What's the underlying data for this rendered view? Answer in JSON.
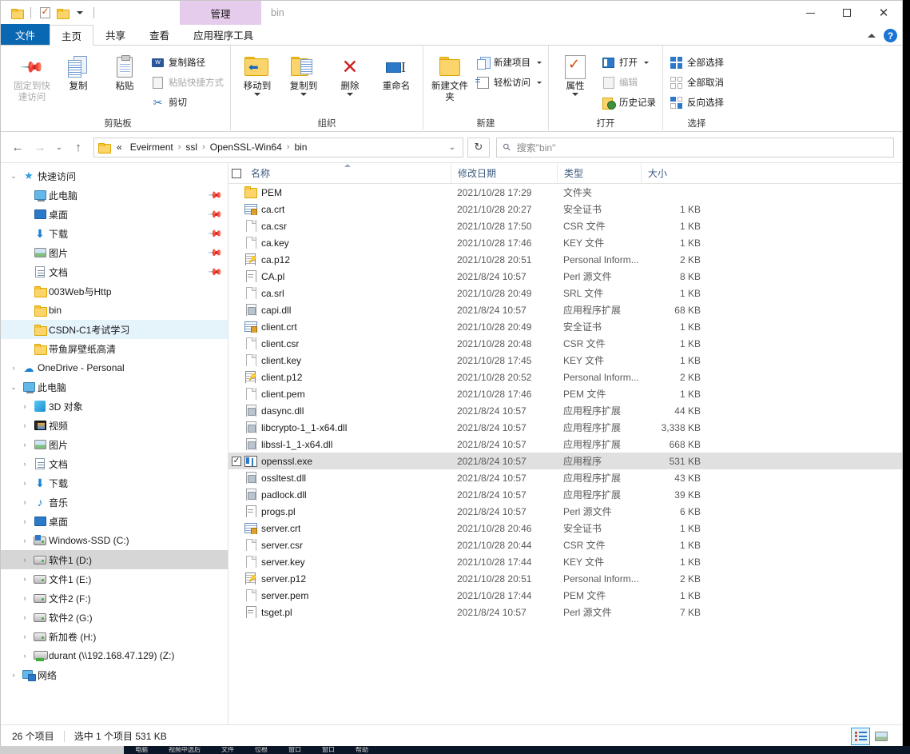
{
  "window": {
    "title": "bin",
    "context_tab": "管理",
    "minimize": "—",
    "maximize": "□",
    "close": "✕"
  },
  "quick_access_toolbar": [
    {
      "name": "qat-folder-properties",
      "icon": "folder-icon"
    },
    {
      "name": "qat-properties",
      "icon": "properties-check-icon"
    },
    {
      "name": "qat-new-folder",
      "icon": "folder-icon"
    },
    {
      "name": "qat-customize",
      "icon": "chevron-down-icon"
    }
  ],
  "tabs": [
    {
      "label": "文件",
      "id": "file",
      "state": "file"
    },
    {
      "label": "主页",
      "id": "home",
      "state": "active"
    },
    {
      "label": "共享",
      "id": "share",
      "state": "normal"
    },
    {
      "label": "查看",
      "id": "view",
      "state": "normal"
    },
    {
      "label": "应用程序工具",
      "id": "apptools",
      "state": "context"
    }
  ],
  "ribbon": {
    "collapse_tooltip": "^",
    "help_label": "?",
    "groups": [
      {
        "title": "剪贴板",
        "big_buttons": [
          {
            "label": "固定到快速访问",
            "icon": "pin-icon",
            "dim": true
          },
          {
            "label": "复制",
            "icon": "copy-icon",
            "dim": false
          },
          {
            "label": "粘贴",
            "icon": "paste-icon",
            "dim": false
          }
        ],
        "small_buttons": [
          {
            "label": "复制路径",
            "icon": "copy-path-icon",
            "dim": false
          },
          {
            "label": "粘贴快捷方式",
            "icon": "paste-shortcut-icon",
            "dim": true
          },
          {
            "label": "剪切",
            "icon": "scissors-icon",
            "dim": false
          }
        ]
      },
      {
        "title": "组织",
        "big_buttons": [
          {
            "label": "移动到",
            "icon": "move-to-icon",
            "caret": true
          },
          {
            "label": "复制到",
            "icon": "copy-to-icon",
            "caret": true
          },
          {
            "label": "删除",
            "icon": "delete-x-icon",
            "caret": true
          },
          {
            "label": "重命名",
            "icon": "rename-icon",
            "caret": false
          }
        ]
      },
      {
        "title": "新建",
        "big_buttons": [
          {
            "label": "新建文件夹",
            "icon": "new-folder-icon"
          }
        ],
        "small_buttons": [
          {
            "label": "新建项目",
            "icon": "new-item-icon",
            "caret": true
          },
          {
            "label": "轻松访问",
            "icon": "easy-access-icon",
            "caret": true
          }
        ]
      },
      {
        "title": "打开",
        "big_buttons": [
          {
            "label": "属性",
            "icon": "properties-icon",
            "caret": true
          }
        ],
        "small_buttons": [
          {
            "label": "打开",
            "icon": "open-icon",
            "caret": true
          },
          {
            "label": "编辑",
            "icon": "edit-icon",
            "dim": true
          },
          {
            "label": "历史记录",
            "icon": "history-icon"
          }
        ]
      },
      {
        "title": "选择",
        "small_buttons": [
          {
            "label": "全部选择",
            "icon": "select-all-icon"
          },
          {
            "label": "全部取消",
            "icon": "select-none-icon"
          },
          {
            "label": "反向选择",
            "icon": "invert-selection-icon"
          }
        ]
      }
    ]
  },
  "address": {
    "back": "←",
    "forward": "→",
    "recent": "⌄",
    "up": "↑",
    "crumbs": [
      "«",
      "Eveirment",
      "ssl",
      "OpenSSL-Win64",
      "bin"
    ],
    "separator": "›",
    "dropdown": "⌄",
    "refresh": "↻",
    "search_placeholder": "搜索\"bin\"",
    "search_value": ""
  },
  "nav_pane": [
    {
      "label": "快速访问",
      "icon": "star-icon",
      "indent": 0,
      "toggle": "expanded",
      "pin": false,
      "state": "normal"
    },
    {
      "label": "此电脑",
      "icon": "pc-icon",
      "indent": 1,
      "toggle": "none",
      "pin": true,
      "state": "normal"
    },
    {
      "label": "桌面",
      "icon": "desktop-icon",
      "indent": 1,
      "toggle": "none",
      "pin": true,
      "state": "normal"
    },
    {
      "label": "下载",
      "icon": "download-icon",
      "indent": 1,
      "toggle": "none",
      "pin": true,
      "state": "normal"
    },
    {
      "label": "图片",
      "icon": "pictures-icon",
      "indent": 1,
      "toggle": "none",
      "pin": true,
      "state": "normal"
    },
    {
      "label": "文档",
      "icon": "documents-icon",
      "indent": 1,
      "toggle": "none",
      "pin": true,
      "state": "normal"
    },
    {
      "label": "003Web与Http",
      "icon": "folder-icon",
      "indent": 1,
      "toggle": "none",
      "pin": false,
      "state": "normal"
    },
    {
      "label": "bin",
      "icon": "folder-icon",
      "indent": 1,
      "toggle": "none",
      "pin": false,
      "state": "normal"
    },
    {
      "label": "CSDN-C1考试学习",
      "icon": "folder-icon",
      "indent": 1,
      "toggle": "none",
      "pin": false,
      "state": "selected"
    },
    {
      "label": "带鱼屏壁纸高清",
      "icon": "folder-icon",
      "indent": 1,
      "toggle": "none",
      "pin": false,
      "state": "normal"
    },
    {
      "label": "OneDrive - Personal",
      "icon": "cloud-icon",
      "indent": 0,
      "toggle": "collapsed",
      "pin": false,
      "state": "normal"
    },
    {
      "label": "此电脑",
      "icon": "pc-icon",
      "indent": 0,
      "toggle": "expanded",
      "pin": false,
      "state": "normal"
    },
    {
      "label": "3D 对象",
      "icon": "3d-objects-icon",
      "indent": 1,
      "toggle": "collapsed",
      "pin": false,
      "state": "normal"
    },
    {
      "label": "视频",
      "icon": "videos-icon",
      "indent": 1,
      "toggle": "collapsed",
      "pin": false,
      "state": "normal"
    },
    {
      "label": "图片",
      "icon": "pictures-icon",
      "indent": 1,
      "toggle": "collapsed",
      "pin": false,
      "state": "normal"
    },
    {
      "label": "文档",
      "icon": "documents-icon",
      "indent": 1,
      "toggle": "collapsed",
      "pin": false,
      "state": "normal"
    },
    {
      "label": "下载",
      "icon": "download-icon",
      "indent": 1,
      "toggle": "collapsed",
      "pin": false,
      "state": "normal"
    },
    {
      "label": "音乐",
      "icon": "music-icon",
      "indent": 1,
      "toggle": "collapsed",
      "pin": false,
      "state": "normal"
    },
    {
      "label": "桌面",
      "icon": "desktop-icon",
      "indent": 1,
      "toggle": "collapsed",
      "pin": false,
      "state": "normal"
    },
    {
      "label": "Windows-SSD (C:)",
      "icon": "drive-windows-icon",
      "indent": 1,
      "toggle": "collapsed",
      "pin": false,
      "state": "normal"
    },
    {
      "label": "软件1 (D:)",
      "icon": "drive-icon",
      "indent": 1,
      "toggle": "collapsed",
      "pin": false,
      "state": "selected-gray"
    },
    {
      "label": "文件1 (E:)",
      "icon": "drive-icon",
      "indent": 1,
      "toggle": "collapsed",
      "pin": false,
      "state": "normal"
    },
    {
      "label": "文件2 (F:)",
      "icon": "drive-icon",
      "indent": 1,
      "toggle": "collapsed",
      "pin": false,
      "state": "normal"
    },
    {
      "label": "软件2 (G:)",
      "icon": "drive-icon",
      "indent": 1,
      "toggle": "collapsed",
      "pin": false,
      "state": "normal"
    },
    {
      "label": "新加卷 (H:)",
      "icon": "drive-icon",
      "indent": 1,
      "toggle": "collapsed",
      "pin": false,
      "state": "normal"
    },
    {
      "label": "durant (\\\\192.168.47.129) (Z:)",
      "icon": "network-drive-icon",
      "indent": 1,
      "toggle": "collapsed",
      "pin": false,
      "state": "normal"
    },
    {
      "label": "网络",
      "icon": "network-icon",
      "indent": 0,
      "toggle": "collapsed",
      "pin": false,
      "state": "normal"
    }
  ],
  "file_list": {
    "columns": [
      {
        "label": "名称",
        "key": "name",
        "sorted": true
      },
      {
        "label": "修改日期",
        "key": "date",
        "sorted": false
      },
      {
        "label": "类型",
        "key": "type",
        "sorted": false
      },
      {
        "label": "大小",
        "key": "size",
        "sorted": false
      }
    ],
    "header_checkbox": false,
    "rows": [
      {
        "name": "PEM",
        "date": "2021/10/28 17:29",
        "type": "文件夹",
        "size": "",
        "icon": "folder-icon",
        "selected": false
      },
      {
        "name": "ca.crt",
        "date": "2021/10/28 20:27",
        "type": "安全证书",
        "size": "1 KB",
        "icon": "certificate-icon",
        "selected": false
      },
      {
        "name": "ca.csr",
        "date": "2021/10/28 17:50",
        "type": "CSR 文件",
        "size": "1 KB",
        "icon": "blank-file-icon",
        "selected": false
      },
      {
        "name": "ca.key",
        "date": "2021/10/28 17:46",
        "type": "KEY 文件",
        "size": "1 KB",
        "icon": "blank-file-icon",
        "selected": false
      },
      {
        "name": "ca.p12",
        "date": "2021/10/28 20:51",
        "type": "Personal Inform...",
        "size": "2 KB",
        "icon": "pfx-icon",
        "selected": false
      },
      {
        "name": "CA.pl",
        "date": "2021/8/24 10:57",
        "type": "Perl 源文件",
        "size": "8 KB",
        "icon": "perl-icon",
        "selected": false
      },
      {
        "name": "ca.srl",
        "date": "2021/10/28 20:49",
        "type": "SRL 文件",
        "size": "1 KB",
        "icon": "blank-file-icon",
        "selected": false
      },
      {
        "name": "capi.dll",
        "date": "2021/8/24 10:57",
        "type": "应用程序扩展",
        "size": "68 KB",
        "icon": "dll-icon",
        "selected": false
      },
      {
        "name": "client.crt",
        "date": "2021/10/28 20:49",
        "type": "安全证书",
        "size": "1 KB",
        "icon": "certificate-icon",
        "selected": false
      },
      {
        "name": "client.csr",
        "date": "2021/10/28 20:48",
        "type": "CSR 文件",
        "size": "1 KB",
        "icon": "blank-file-icon",
        "selected": false
      },
      {
        "name": "client.key",
        "date": "2021/10/28 17:45",
        "type": "KEY 文件",
        "size": "1 KB",
        "icon": "blank-file-icon",
        "selected": false
      },
      {
        "name": "client.p12",
        "date": "2021/10/28 20:52",
        "type": "Personal Inform...",
        "size": "2 KB",
        "icon": "pfx-icon",
        "selected": false
      },
      {
        "name": "client.pem",
        "date": "2021/10/28 17:46",
        "type": "PEM 文件",
        "size": "1 KB",
        "icon": "blank-file-icon",
        "selected": false
      },
      {
        "name": "dasync.dll",
        "date": "2021/8/24 10:57",
        "type": "应用程序扩展",
        "size": "44 KB",
        "icon": "dll-icon",
        "selected": false
      },
      {
        "name": "libcrypto-1_1-x64.dll",
        "date": "2021/8/24 10:57",
        "type": "应用程序扩展",
        "size": "3,338 KB",
        "icon": "dll-icon",
        "selected": false
      },
      {
        "name": "libssl-1_1-x64.dll",
        "date": "2021/8/24 10:57",
        "type": "应用程序扩展",
        "size": "668 KB",
        "icon": "dll-icon",
        "selected": false
      },
      {
        "name": "openssl.exe",
        "date": "2021/8/24 10:57",
        "type": "应用程序",
        "size": "531 KB",
        "icon": "exe-icon",
        "selected": true
      },
      {
        "name": "ossltest.dll",
        "date": "2021/8/24 10:57",
        "type": "应用程序扩展",
        "size": "43 KB",
        "icon": "dll-icon",
        "selected": false
      },
      {
        "name": "padlock.dll",
        "date": "2021/8/24 10:57",
        "type": "应用程序扩展",
        "size": "39 KB",
        "icon": "dll-icon",
        "selected": false
      },
      {
        "name": "progs.pl",
        "date": "2021/8/24 10:57",
        "type": "Perl 源文件",
        "size": "6 KB",
        "icon": "perl-icon",
        "selected": false
      },
      {
        "name": "server.crt",
        "date": "2021/10/28 20:46",
        "type": "安全证书",
        "size": "1 KB",
        "icon": "certificate-icon",
        "selected": false
      },
      {
        "name": "server.csr",
        "date": "2021/10/28 20:44",
        "type": "CSR 文件",
        "size": "1 KB",
        "icon": "blank-file-icon",
        "selected": false
      },
      {
        "name": "server.key",
        "date": "2021/10/28 17:44",
        "type": "KEY 文件",
        "size": "1 KB",
        "icon": "blank-file-icon",
        "selected": false
      },
      {
        "name": "server.p12",
        "date": "2021/10/28 20:51",
        "type": "Personal Inform...",
        "size": "2 KB",
        "icon": "pfx-icon",
        "selected": false
      },
      {
        "name": "server.pem",
        "date": "2021/10/28 17:44",
        "type": "PEM 文件",
        "size": "1 KB",
        "icon": "blank-file-icon",
        "selected": false
      },
      {
        "name": "tsget.pl",
        "date": "2021/8/24 10:57",
        "type": "Perl 源文件",
        "size": "7 KB",
        "icon": "perl-icon",
        "selected": false
      }
    ]
  },
  "status": {
    "item_count": "26 个项目",
    "selection": "选中 1 个项目  531 KB",
    "views": [
      {
        "name": "details-view-button",
        "icon": "details-view-icon",
        "active": true
      },
      {
        "name": "large-icons-view-button",
        "icon": "tiles-view-icon",
        "active": false
      }
    ]
  },
  "taskbar": {
    "items": [
      "电脑",
      "视频中选后",
      "文件",
      "位根",
      "窗口",
      "窗口",
      "帮助"
    ]
  },
  "colors": {
    "accent": "#0a67b1",
    "context_tab": "#e6ccec",
    "selection_gray": "#e0e0e0",
    "selection_blue": "#e5f3fb",
    "header_text": "#3d5a80"
  }
}
